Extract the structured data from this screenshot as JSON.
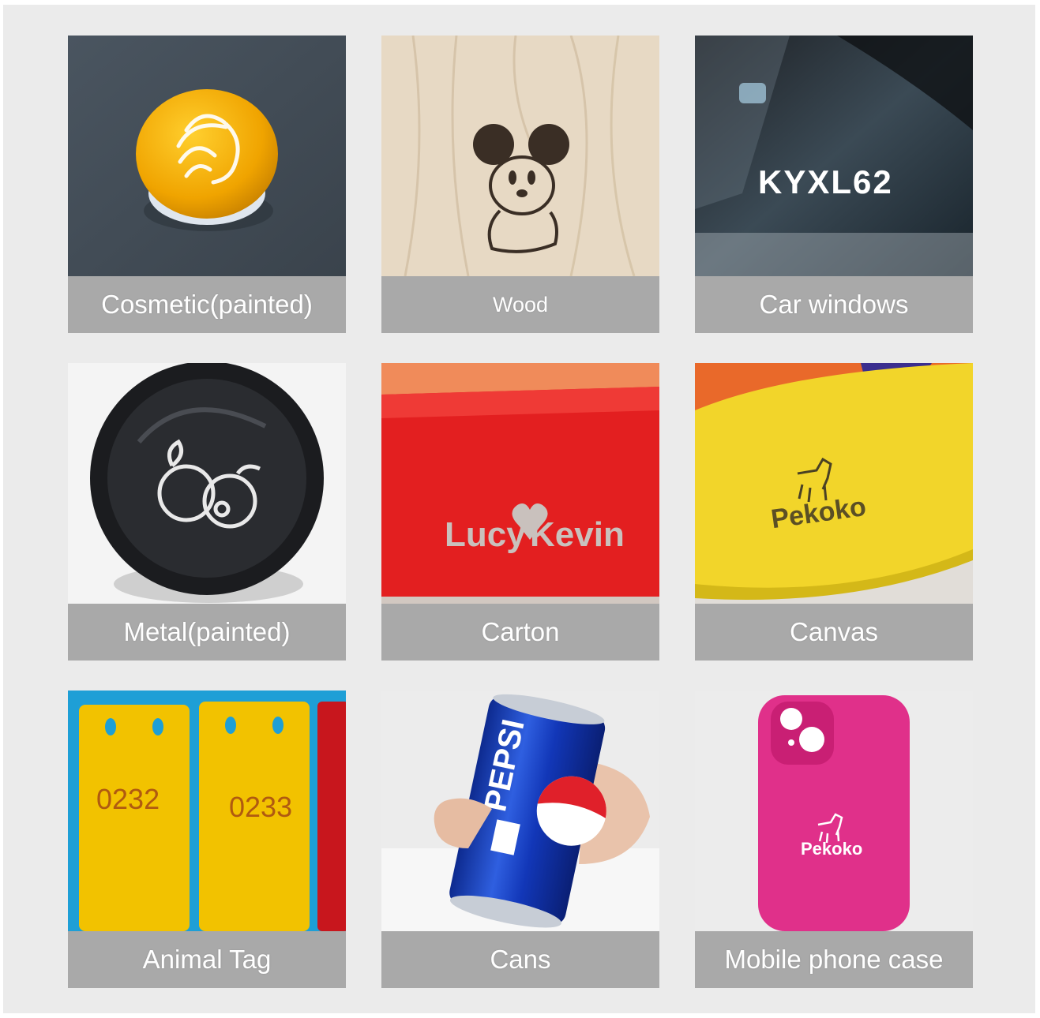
{
  "tiles": [
    {
      "caption": "Cosmetic(painted)"
    },
    {
      "caption": "Wood"
    },
    {
      "caption": "Car windows",
      "engraving": "KYXL62"
    },
    {
      "caption": "Metal(painted)"
    },
    {
      "caption": "Carton",
      "engraving_left": "Lucy",
      "engraving_right": "Kevin"
    },
    {
      "caption": "Canvas",
      "engraving": "Pekoko"
    },
    {
      "caption": "Animal Tag",
      "tag_numbers": [
        "0232",
        "0233"
      ]
    },
    {
      "caption": "Cans",
      "brand": "PEPSI"
    },
    {
      "caption": "Mobile phone case",
      "engraving": "Pekoko"
    }
  ],
  "colors": {
    "background": "#ebebeb",
    "caption_bar": "#a9a9a9",
    "caption_text": "#ffffff"
  }
}
